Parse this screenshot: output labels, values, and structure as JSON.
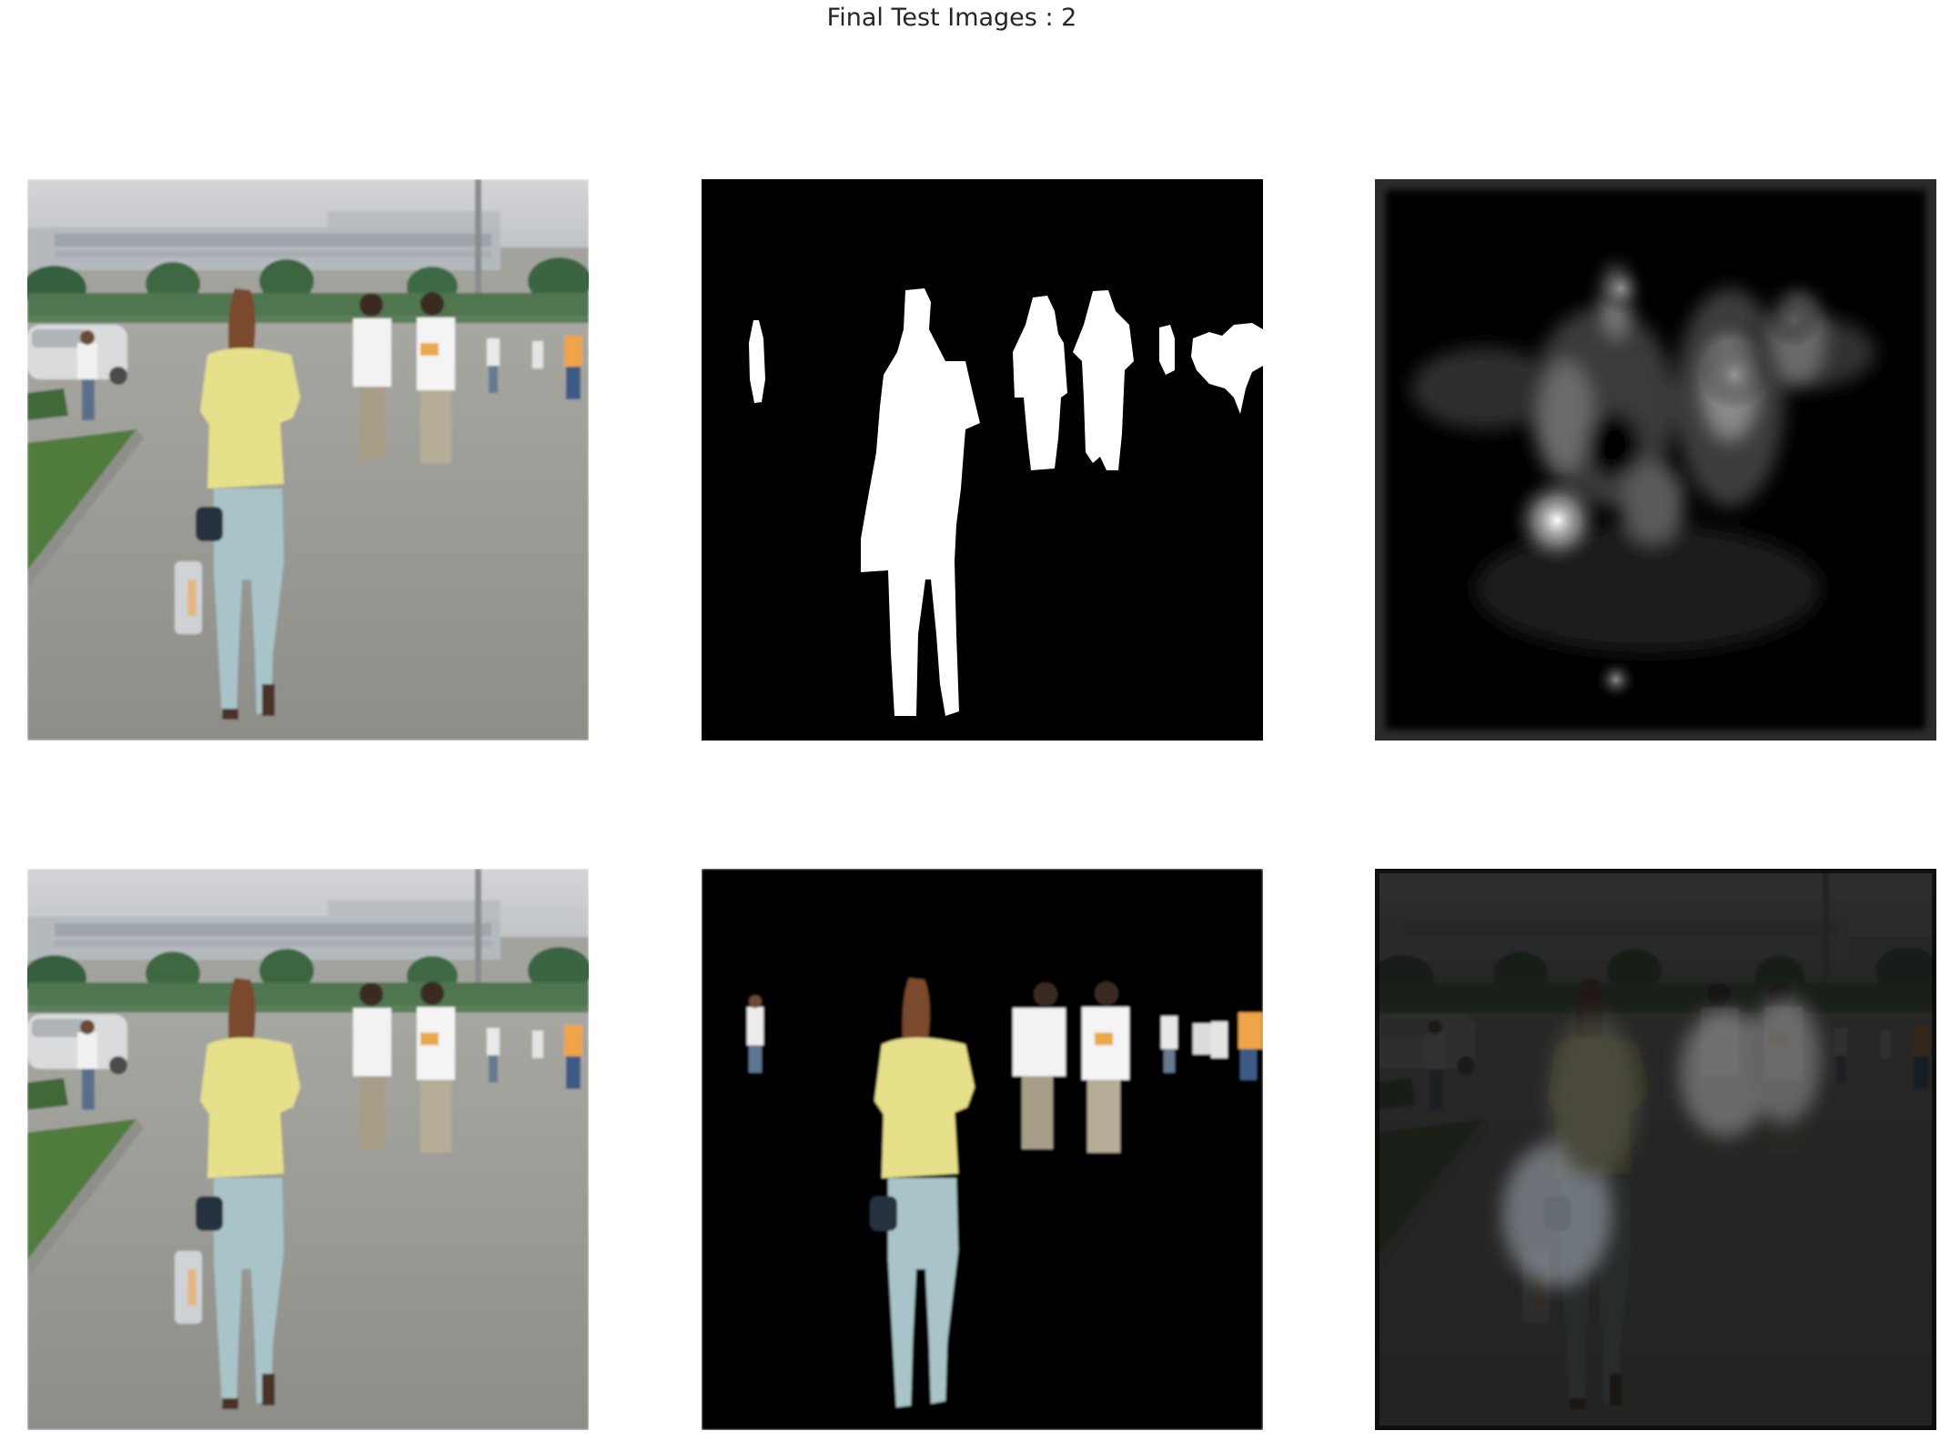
{
  "figure": {
    "title": "Final Test Images : 2"
  },
  "panels": [
    {
      "row": 1,
      "col": 1,
      "kind": "input-photo"
    },
    {
      "row": 1,
      "col": 2,
      "kind": "binary-mask"
    },
    {
      "row": 1,
      "col": 3,
      "kind": "saliency-heatmap"
    },
    {
      "row": 2,
      "col": 1,
      "kind": "input-photo"
    },
    {
      "row": 2,
      "col": 2,
      "kind": "masked-photo"
    },
    {
      "row": 2,
      "col": 3,
      "kind": "attention-overlay"
    }
  ],
  "colors": {
    "background": "#ffffff",
    "title_text": "#262626",
    "sky": "#c9ccd0",
    "building": "#aeb3b8",
    "trees": "#3e6a44",
    "hedge": "#4f7650",
    "pavement": "#9c9c96",
    "grass": "#4f7b3c",
    "shirt_yellow": "#e6e08a",
    "jeans": "#a9c4c8",
    "hair": "#7a4a2e",
    "mask_fg": "#ffffff",
    "mask_bg": "#000000"
  }
}
